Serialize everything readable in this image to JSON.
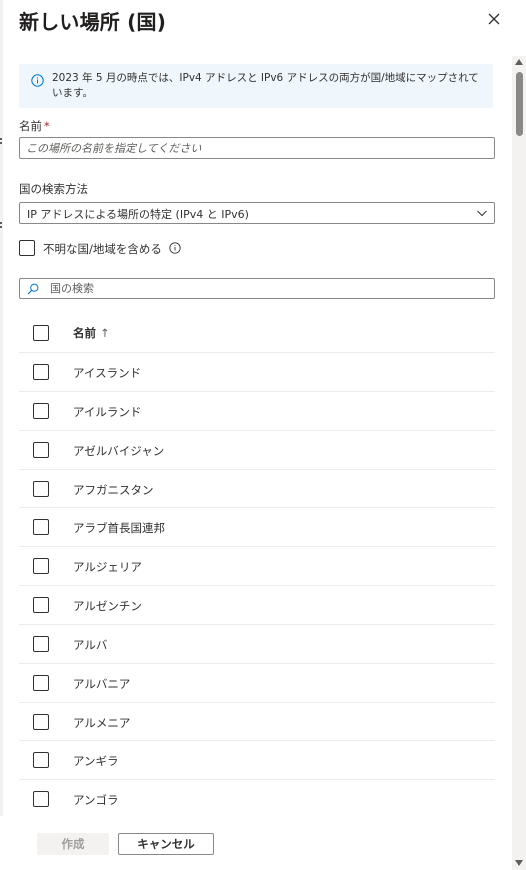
{
  "panel": {
    "title": "新しい場所 (国)",
    "close_icon": "close-icon"
  },
  "info": {
    "icon": "info-icon",
    "text": "2023 年 5 月の時点では、IPv4 アドレスと IPv6 アドレスの両方が国/地域にマップされています。"
  },
  "name_field": {
    "label": "名前",
    "required_marker": "*",
    "value": "",
    "placeholder": "この場所の名前を指定してください"
  },
  "lookup_method": {
    "label": "国の検索方法",
    "selected": "IP アドレスによる場所の特定 (IPv4 と IPv6)",
    "chevron_icon": "chevron-down-icon"
  },
  "unknown_regions": {
    "label": "不明な国/地域を含める",
    "checked": false,
    "info_icon": "info-icon"
  },
  "search": {
    "icon": "search-icon",
    "placeholder": "国の検索",
    "value": ""
  },
  "table": {
    "header": {
      "name": "名前",
      "sort_indicator": "↑"
    },
    "rows": [
      {
        "name": "アイスランド",
        "checked": false
      },
      {
        "name": "アイルランド",
        "checked": false
      },
      {
        "name": "アゼルバイジャン",
        "checked": false
      },
      {
        "name": "アフガニスタン",
        "checked": false
      },
      {
        "name": "アラブ首長国連邦",
        "checked": false
      },
      {
        "name": "アルジェリア",
        "checked": false
      },
      {
        "name": "アルゼンチン",
        "checked": false
      },
      {
        "name": "アルバ",
        "checked": false
      },
      {
        "name": "アルバニア",
        "checked": false
      },
      {
        "name": "アルメニア",
        "checked": false
      },
      {
        "name": "アンギラ",
        "checked": false
      },
      {
        "name": "アンゴラ",
        "checked": false
      }
    ]
  },
  "footer": {
    "create_label": "作成",
    "cancel_label": "キャンセル"
  },
  "colors": {
    "info_background": "#eff6fc",
    "info_icon": "#0078d4",
    "required": "#a4262c",
    "border": "#8a8886",
    "divider": "#edebe9",
    "disabled_text": "#a19f9d",
    "disabled_background": "#f3f2f1"
  }
}
